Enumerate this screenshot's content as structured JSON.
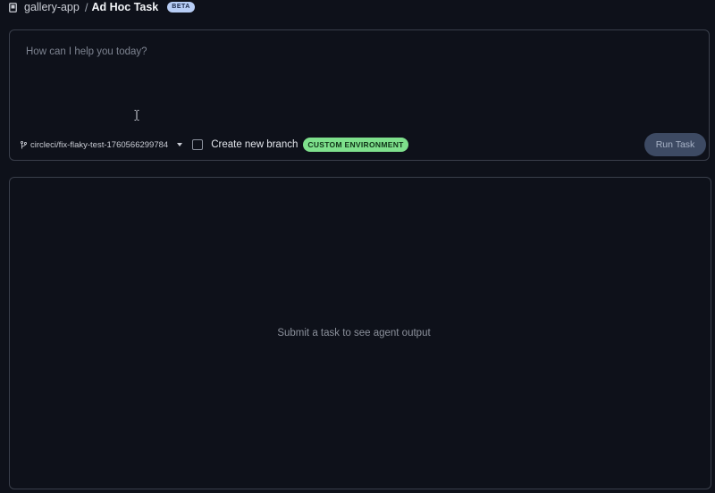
{
  "header": {
    "repo_name": "gallery-app",
    "separator": "/",
    "title": "Ad Hoc Task",
    "badge": "BETA"
  },
  "prompt": {
    "placeholder": "How can I help you today?",
    "value": ""
  },
  "controls": {
    "branch": "circleci/fix-flaky-test-1760566299784",
    "create_branch_label": "Create new branch",
    "create_branch_checked": false,
    "environment_badge": "CUSTOM ENVIRONMENT",
    "run_button_label": "Run Task"
  },
  "output": {
    "empty_message": "Submit a task to see agent output"
  },
  "colors": {
    "background": "#0e111a",
    "border": "#3a3f4b",
    "beta_badge": "#b7cdf5",
    "environment_badge": "#7ee08c",
    "run_button": "#3d4a63"
  },
  "icons": {
    "repo": "repo-icon",
    "branch": "git-branch-icon",
    "dropdown": "chevron-down-icon",
    "text_cursor": "text-cursor-icon"
  }
}
